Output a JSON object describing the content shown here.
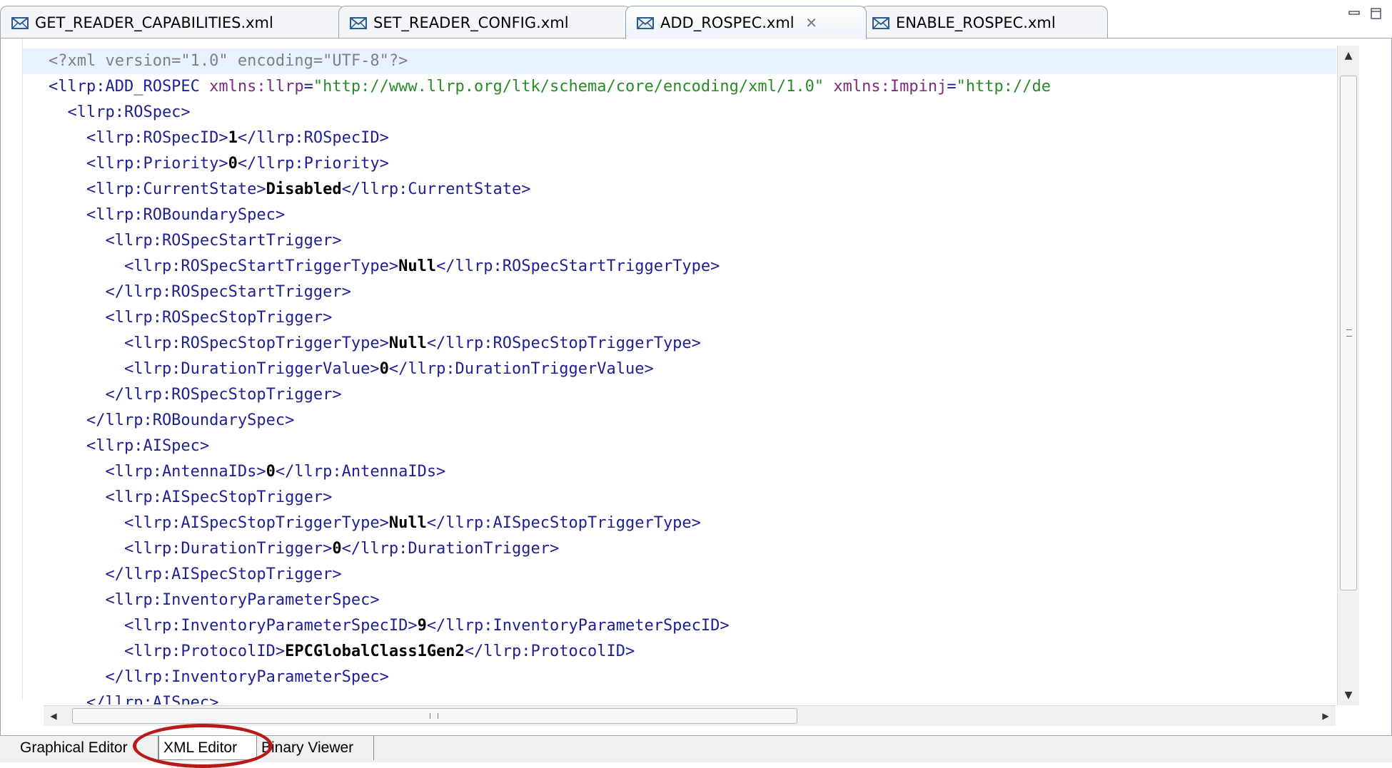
{
  "tabs": [
    {
      "label": "GET_READER_CAPABILITIES.xml",
      "active": false
    },
    {
      "label": "SET_READER_CONFIG.xml",
      "active": false
    },
    {
      "label": "ADD_ROSPEC.xml",
      "active": true,
      "close": "✕"
    },
    {
      "label": "ENABLE_ROSPEC.xml",
      "active": false
    }
  ],
  "editor": {
    "lines": [
      [
        {
          "c": "pi",
          "t": "<?xml version=\"1.0\" encoding=\"UTF-8\"?>"
        }
      ],
      [
        {
          "c": "t",
          "t": "<llrp:ADD_ROSPEC "
        },
        {
          "c": "a",
          "t": "xmlns:llrp"
        },
        {
          "c": "t",
          "t": "="
        },
        {
          "c": "s",
          "t": "\"http://www.llrp.org/ltk/schema/core/encoding/xml/1.0\""
        },
        {
          "c": "t",
          "t": " "
        },
        {
          "c": "a",
          "t": "xmlns:Impinj"
        },
        {
          "c": "t",
          "t": "="
        },
        {
          "c": "s",
          "t": "\"http://de"
        }
      ],
      [
        {
          "c": "t",
          "t": "  <llrp:ROSpec>"
        }
      ],
      [
        {
          "c": "t",
          "t": "    <llrp:ROSpecID>"
        },
        {
          "c": "v",
          "t": "1"
        },
        {
          "c": "t",
          "t": "</llrp:ROSpecID>"
        }
      ],
      [
        {
          "c": "t",
          "t": "    <llrp:Priority>"
        },
        {
          "c": "v",
          "t": "0"
        },
        {
          "c": "t",
          "t": "</llrp:Priority>"
        }
      ],
      [
        {
          "c": "t",
          "t": "    <llrp:CurrentState>"
        },
        {
          "c": "v",
          "t": "Disabled"
        },
        {
          "c": "t",
          "t": "</llrp:CurrentState>"
        }
      ],
      [
        {
          "c": "t",
          "t": "    <llrp:ROBoundarySpec>"
        }
      ],
      [
        {
          "c": "t",
          "t": "      <llrp:ROSpecStartTrigger>"
        }
      ],
      [
        {
          "c": "t",
          "t": "        <llrp:ROSpecStartTriggerType>"
        },
        {
          "c": "v",
          "t": "Null"
        },
        {
          "c": "t",
          "t": "</llrp:ROSpecStartTriggerType>"
        }
      ],
      [
        {
          "c": "t",
          "t": "      </llrp:ROSpecStartTrigger>"
        }
      ],
      [
        {
          "c": "t",
          "t": "      <llrp:ROSpecStopTrigger>"
        }
      ],
      [
        {
          "c": "t",
          "t": "        <llrp:ROSpecStopTriggerType>"
        },
        {
          "c": "v",
          "t": "Null"
        },
        {
          "c": "t",
          "t": "</llrp:ROSpecStopTriggerType>"
        }
      ],
      [
        {
          "c": "t",
          "t": "        <llrp:DurationTriggerValue>"
        },
        {
          "c": "v",
          "t": "0"
        },
        {
          "c": "t",
          "t": "</llrp:DurationTriggerValue>"
        }
      ],
      [
        {
          "c": "t",
          "t": "      </llrp:ROSpecStopTrigger>"
        }
      ],
      [
        {
          "c": "t",
          "t": "    </llrp:ROBoundarySpec>"
        }
      ],
      [
        {
          "c": "t",
          "t": "    <llrp:AISpec>"
        }
      ],
      [
        {
          "c": "t",
          "t": "      <llrp:AntennaIDs>"
        },
        {
          "c": "v",
          "t": "0"
        },
        {
          "c": "t",
          "t": "</llrp:AntennaIDs>"
        }
      ],
      [
        {
          "c": "t",
          "t": "      <llrp:AISpecStopTrigger>"
        }
      ],
      [
        {
          "c": "t",
          "t": "        <llrp:AISpecStopTriggerType>"
        },
        {
          "c": "v",
          "t": "Null"
        },
        {
          "c": "t",
          "t": "</llrp:AISpecStopTriggerType>"
        }
      ],
      [
        {
          "c": "t",
          "t": "        <llrp:DurationTrigger>"
        },
        {
          "c": "v",
          "t": "0"
        },
        {
          "c": "t",
          "t": "</llrp:DurationTrigger>"
        }
      ],
      [
        {
          "c": "t",
          "t": "      </llrp:AISpecStopTrigger>"
        }
      ],
      [
        {
          "c": "t",
          "t": "      <llrp:InventoryParameterSpec>"
        }
      ],
      [
        {
          "c": "t",
          "t": "        <llrp:InventoryParameterSpecID>"
        },
        {
          "c": "v",
          "t": "9"
        },
        {
          "c": "t",
          "t": "</llrp:InventoryParameterSpecID>"
        }
      ],
      [
        {
          "c": "t",
          "t": "        <llrp:ProtocolID>"
        },
        {
          "c": "v",
          "t": "EPCGlobalClass1Gen2"
        },
        {
          "c": "t",
          "t": "</llrp:ProtocolID>"
        }
      ],
      [
        {
          "c": "t",
          "t": "      </llrp:InventoryParameterSpec>"
        }
      ],
      [
        {
          "c": "t",
          "t": "    </llrp:AISpec>"
        }
      ]
    ]
  },
  "bottom_tabs": [
    {
      "label": "Graphical Editor",
      "active": false
    },
    {
      "label": "XML Editor",
      "active": true
    },
    {
      "label": "Binary Viewer",
      "active": false
    }
  ],
  "colors": {
    "tag": "#1f1f94",
    "value": "#000000",
    "attribute": "#7b2d7b",
    "string": "#2a8a2a",
    "processing_instruction": "#808080",
    "highlight_ring": "#b81a1a"
  },
  "icons": {
    "tab_icon": "envelope-icon",
    "minimize": "minimize-icon",
    "maximize": "maximize-icon"
  }
}
